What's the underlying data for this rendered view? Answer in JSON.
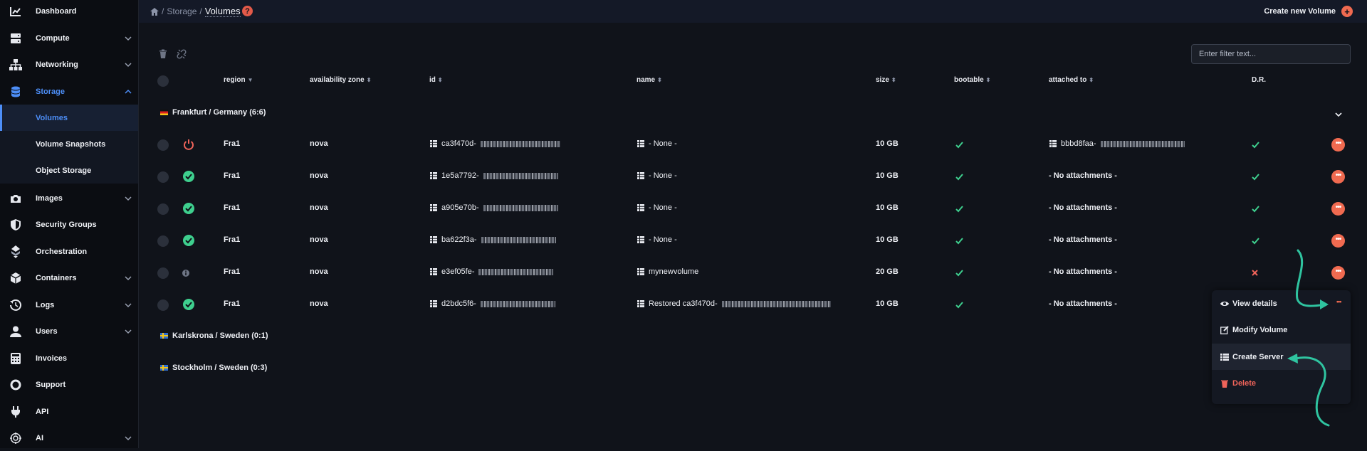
{
  "sidebar": {
    "items": [
      {
        "label": "Dashboard",
        "icon": "chart-icon"
      },
      {
        "label": "Compute",
        "icon": "server-icon"
      },
      {
        "label": "Networking",
        "icon": "network-icon"
      },
      {
        "label": "Storage",
        "icon": "database-icon"
      },
      {
        "label": "Images",
        "icon": "camera-icon"
      },
      {
        "label": "Security Groups",
        "icon": "shield-icon"
      },
      {
        "label": "Orchestration",
        "icon": "orchestration-icon"
      },
      {
        "label": "Containers",
        "icon": "cube-icon"
      },
      {
        "label": "Logs",
        "icon": "history-icon"
      },
      {
        "label": "Users",
        "icon": "user-icon"
      },
      {
        "label": "Invoices",
        "icon": "calculator-icon"
      },
      {
        "label": "Support",
        "icon": "lifebuoy-icon"
      },
      {
        "label": "API",
        "icon": "plug-icon"
      },
      {
        "label": "AI",
        "icon": "ai-icon"
      }
    ],
    "storage_sub": [
      "Volumes",
      "Volume Snapshots",
      "Object Storage"
    ]
  },
  "header": {
    "crumb_storage": "Storage",
    "sep": "/",
    "current": "Volumes",
    "help": "?",
    "create_new": "Create new Volume"
  },
  "filter": {
    "placeholder": "Enter filter text..."
  },
  "columns": {
    "region": "region",
    "az": "availability zone",
    "id": "id",
    "name": "name",
    "size": "size",
    "bootable": "bootable",
    "attached": "attached to",
    "dr": "D.R."
  },
  "groups": [
    {
      "label": "Frankfurt / Germany (6:6)"
    },
    {
      "label": "Karlskrona / Sweden (0:1)"
    },
    {
      "label": "Stockholm / Sweden (0:3)"
    }
  ],
  "rows": [
    {
      "status": "power-icon",
      "region": "Fra1",
      "az": "nova",
      "id": "ca3f470d-",
      "name": "- None -",
      "size": "10 GB",
      "attached": "bbbd8faa-",
      "dr": "check"
    },
    {
      "status": "check-circle-icon",
      "region": "Fra1",
      "az": "nova",
      "id": "1e5a7792-",
      "name": "- None -",
      "size": "10 GB",
      "attached": "- No attachments -",
      "dr": "check"
    },
    {
      "status": "check-circle-icon",
      "region": "Fra1",
      "az": "nova",
      "id": "a905e70b-",
      "name": "- None -",
      "size": "10 GB",
      "attached": "- No attachments -",
      "dr": "check"
    },
    {
      "status": "check-circle-icon",
      "region": "Fra1",
      "az": "nova",
      "id": "ba622f3a-",
      "name": "- None -",
      "size": "10 GB",
      "attached": "- No attachments -",
      "dr": "check"
    },
    {
      "status": "info-icon",
      "region": "Fra1",
      "az": "nova",
      "id": "e3ef05fe-",
      "name": "mynewvolume",
      "size": "20 GB",
      "attached": "- No attachments -",
      "dr": "cross"
    },
    {
      "status": "check-circle-icon",
      "region": "Fra1",
      "az": "nova",
      "id": "d2bdc5f6-",
      "name": "Restored ca3f470d-",
      "size": "10 GB",
      "attached": "- No attachments -",
      "dr": ""
    }
  ],
  "menu": {
    "view": "View details",
    "modify": "Modify Volume",
    "create": "Create Server",
    "delete": "Delete"
  },
  "colors": {
    "accent": "#4d8ef7",
    "success": "#3ecf8e",
    "danger": "#f0645a",
    "action": "#f06a50",
    "annotation": "#2fc4a0"
  }
}
